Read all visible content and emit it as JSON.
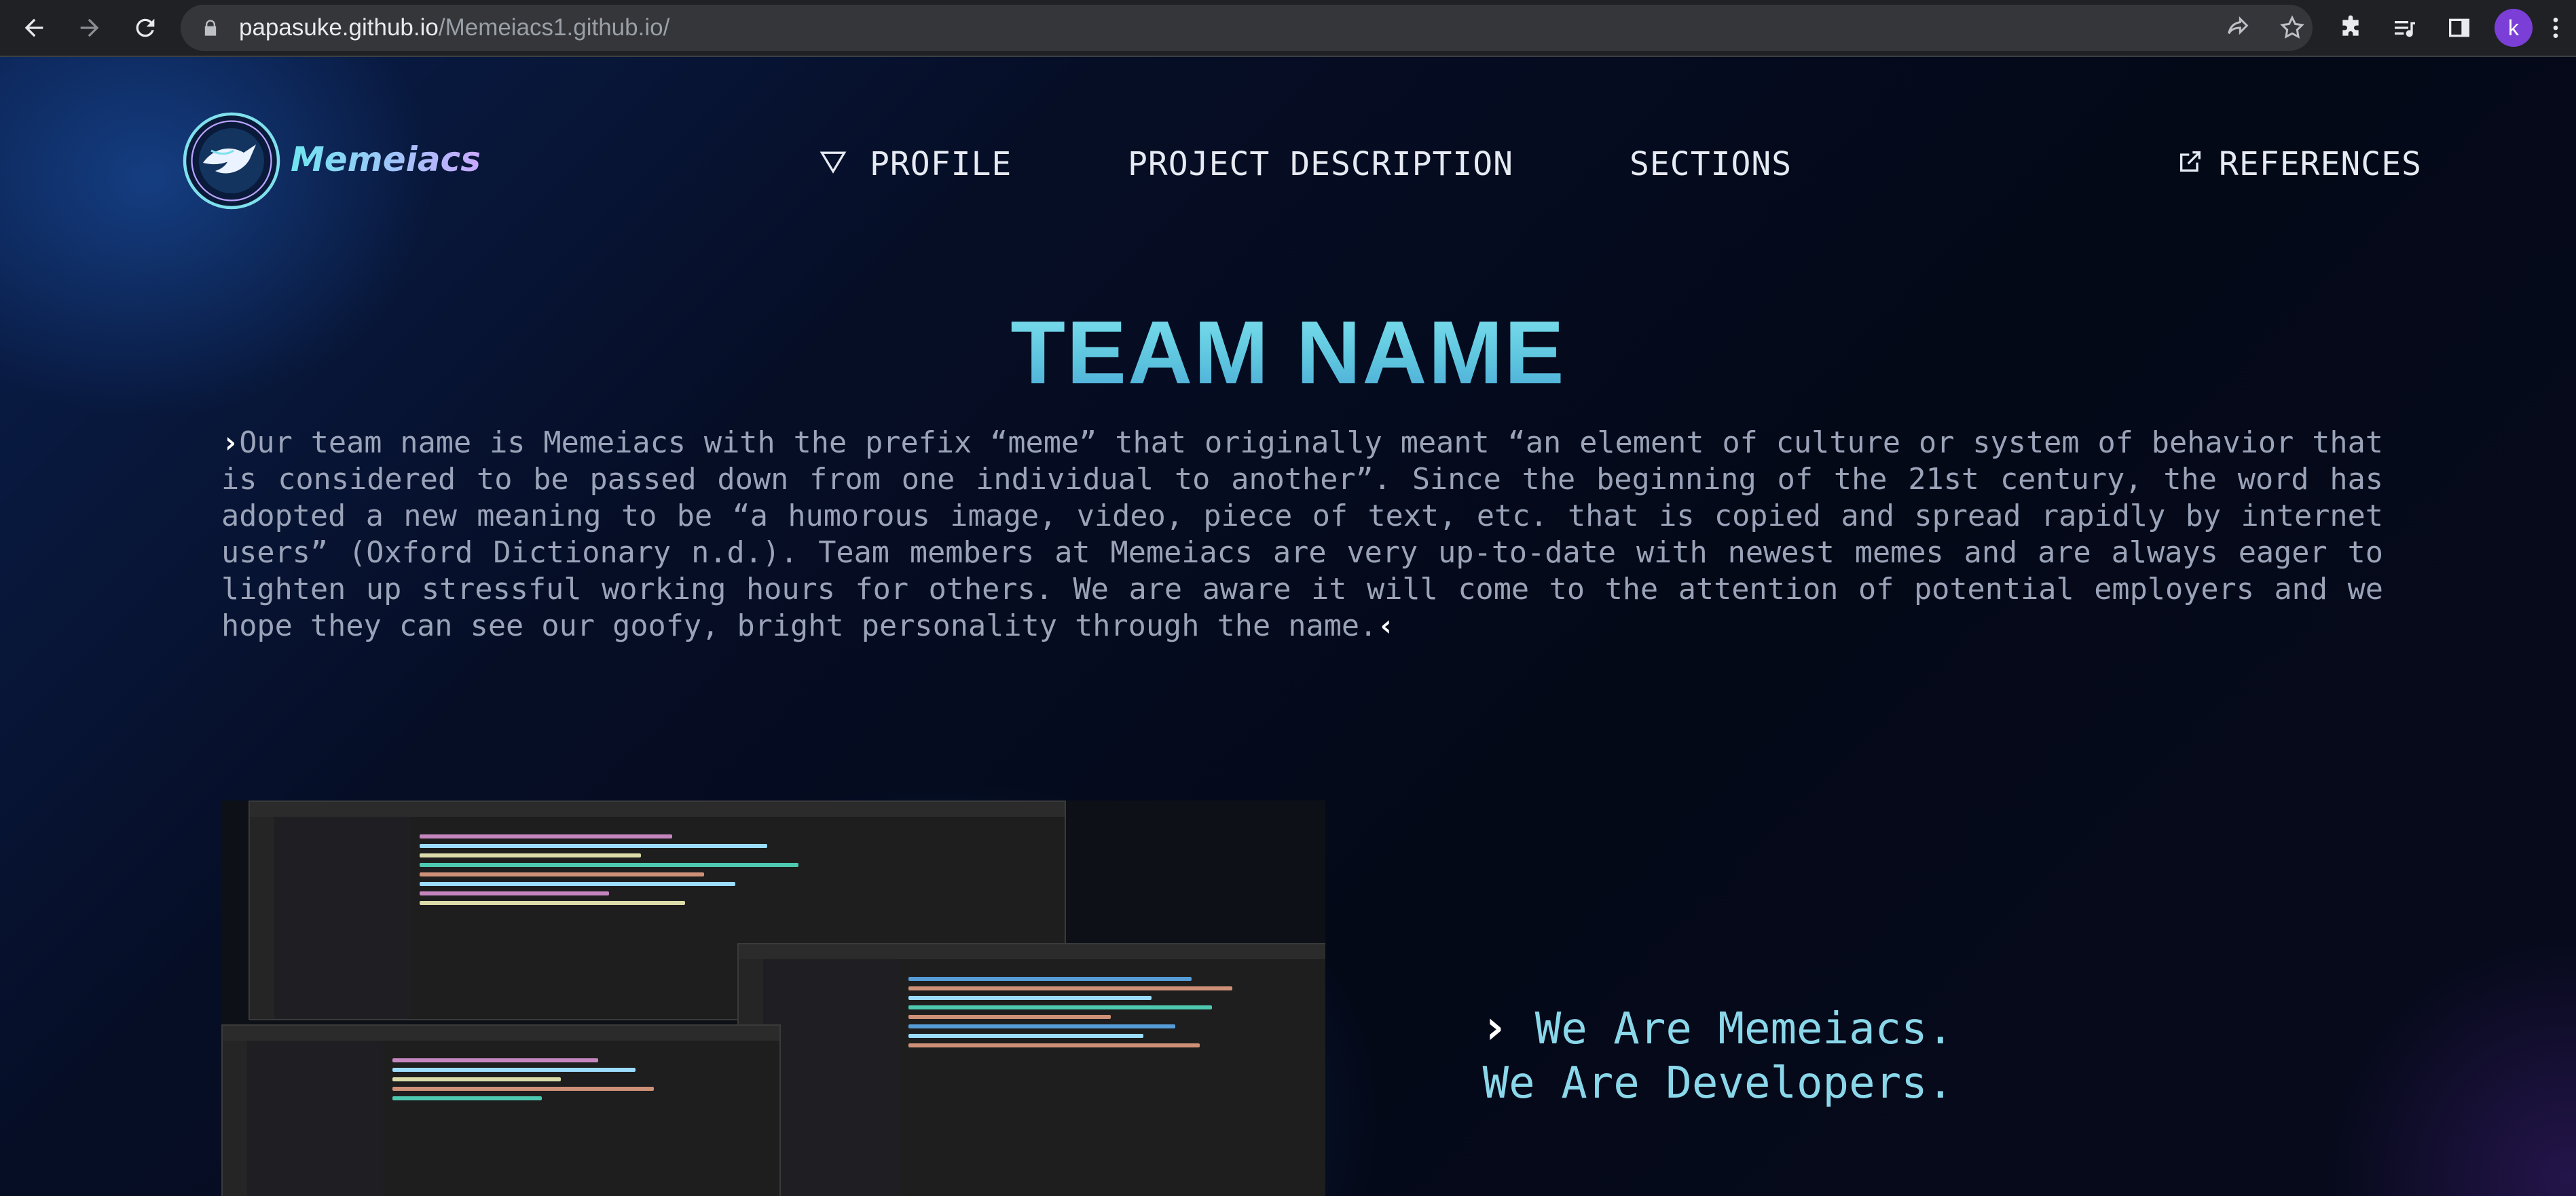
{
  "browser": {
    "url_host": "papasuke.github.io",
    "url_path": "/Memeiacs1.github.io/",
    "profile_initial": "k"
  },
  "site": {
    "brand": "Memeiacs",
    "nav": {
      "profile": "PROFILE",
      "project_description": "PROJECT DESCRIPTION",
      "sections": "SECTIONS",
      "references": "REFERENCES"
    }
  },
  "hero": {
    "title": "TEAM NAME",
    "paragraph": "Our team name is Memeiacs with the prefix “meme” that originally meant “an element of culture or system of behavior that is considered to be passed down from one individual to another”. Since the beginning of the 21st century, the word has adopted a new meaning to be “a humorous image, video, piece of text, etc. that is copied and spread rapidly by internet users” (Oxford Dictionary n.d.). Team members at Memeiacs are very up-to-date with newest memes and are always eager to lighten up stressful working hours for others. We are aware it will come to the attention of potential employers and we hope they can see our goofy, bright personality through the name."
  },
  "showcase": {
    "tagline_line1": "We Are Memeiacs.",
    "tagline_line2": "We Are Developers."
  },
  "colors": {
    "accent": "#5cc3de",
    "background": "#050a1a",
    "text_muted": "#9aa3b8"
  }
}
